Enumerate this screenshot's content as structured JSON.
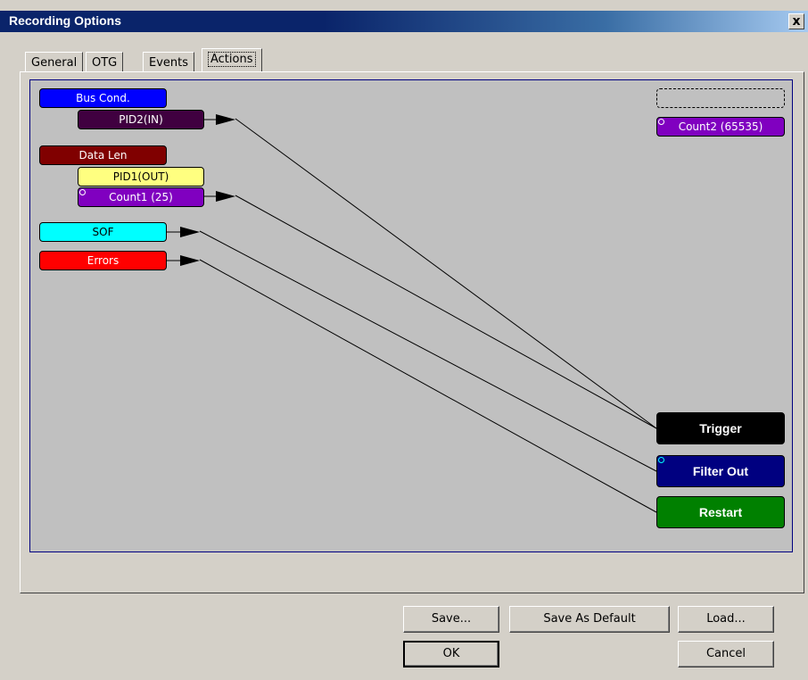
{
  "window": {
    "title": "Recording Options",
    "close_label": "x"
  },
  "tabs": [
    {
      "label": "General"
    },
    {
      "label": "OTG"
    },
    {
      "label": "Events"
    },
    {
      "label": "Actions",
      "active": true
    }
  ],
  "events": {
    "bus_cond": "Bus Cond.",
    "pid2_in": "PID2(IN)",
    "data_len": "Data Len",
    "pid1_out": "PID1(OUT)",
    "count1": "Count1 (25)",
    "sof": "SOF",
    "errors": "Errors",
    "count2": "Count2 (65535)"
  },
  "actions": {
    "trigger": "Trigger",
    "filter_out": "Filter Out",
    "restart": "Restart"
  },
  "buttons": {
    "save": "Save...",
    "save_default": "Save As Default",
    "load": "Load...",
    "ok": "OK",
    "cancel": "Cancel"
  },
  "colors": {
    "bus_cond": "#0000ff",
    "pid2": "#400040",
    "data_len": "#800000",
    "pid1": "#ffff80",
    "count": "#8000c0",
    "sof": "#00ffff",
    "errors": "#ff0000",
    "trigger": "#000000",
    "filter_out": "#000080",
    "restart": "#008000"
  }
}
